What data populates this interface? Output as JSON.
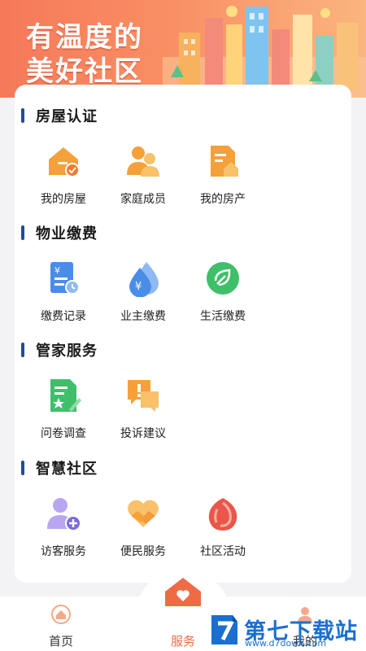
{
  "banner": {
    "title_line1": "有温度的",
    "title_line2": "美好社区"
  },
  "sections": [
    {
      "title": "房屋认证",
      "items": [
        {
          "label": "我的房屋",
          "icon": "house-check-icon"
        },
        {
          "label": "家庭成员",
          "icon": "family-members-icon"
        },
        {
          "label": "我的房产",
          "icon": "property-document-icon"
        }
      ]
    },
    {
      "title": "物业缴费",
      "items": [
        {
          "label": "缴费记录",
          "icon": "payment-record-icon"
        },
        {
          "label": "业主缴费",
          "icon": "owner-payment-drop-icon"
        },
        {
          "label": "生活缴费",
          "icon": "life-payment-leaf-icon"
        }
      ]
    },
    {
      "title": "管家服务",
      "items": [
        {
          "label": "问卷调查",
          "icon": "survey-icon"
        },
        {
          "label": "投诉建议",
          "icon": "complaint-chat-icon"
        }
      ]
    },
    {
      "title": "智慧社区",
      "items": [
        {
          "label": "访客服务",
          "icon": "visitor-add-icon"
        },
        {
          "label": "便民服务",
          "icon": "convenience-heart-icon"
        },
        {
          "label": "社区活动",
          "icon": "community-activity-icon"
        }
      ]
    }
  ],
  "tabbar": {
    "home": "首页",
    "service": "服务",
    "mine": "我的"
  },
  "watermark": {
    "name": "第七下载站",
    "url": "www.d7down.com"
  },
  "colors": {
    "accent": "#ef6b45",
    "section_bar": "#1f4e95",
    "blue_icon": "#4a8de8",
    "green_icon": "#3fbf6a",
    "orange_icon": "#f5a03a"
  }
}
